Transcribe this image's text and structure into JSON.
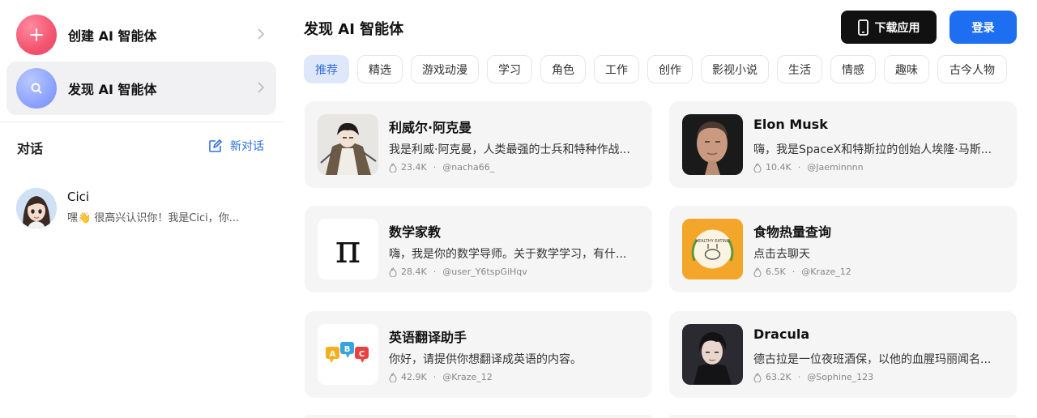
{
  "sidebar": {
    "create_label": "创建 AI 智能体",
    "discover_label": "发现 AI 智能体",
    "conversations_title": "对话",
    "new_chat_label": "新对话",
    "chats": [
      {
        "name": "Cici",
        "preview": "嘿👋 很高兴认识你！我是Cici，你..."
      }
    ]
  },
  "header": {
    "title": "发现 AI 智能体",
    "download_label": "下载应用",
    "login_label": "登录"
  },
  "tabs": [
    "推荐",
    "精选",
    "游戏动漫",
    "学习",
    "角色",
    "工作",
    "创作",
    "影视小说",
    "生活",
    "情感",
    "趣味",
    "古今人物"
  ],
  "active_tab": "推荐",
  "bots": [
    {
      "name": "利威尔·阿克曼",
      "desc": "我是利威·阿克曼，人类最强的士兵和特种作战...",
      "count": "23.4K",
      "author": "@nacha66_",
      "thumb": "anime-character-avatar"
    },
    {
      "name": "Elon Musk",
      "desc": "嗨，我是SpaceX和特斯拉的创始人埃隆·马斯...",
      "count": "10.4K",
      "author": "@Jaeminnnn",
      "thumb": "portrait-photo"
    },
    {
      "name": "数学家教",
      "desc": "嗨，我是你的数学导师。关于数学学习，有什...",
      "count": "28.4K",
      "author": "@user_Y6tspGiHqv",
      "thumb": "pi-symbol",
      "thumb_text": "π"
    },
    {
      "name": "食物热量查询",
      "desc": "点击去聊天",
      "count": "6.5K",
      "author": "@Kraze_12",
      "thumb": "healthy-eating-logo",
      "thumb_text": "HEALTHY EATING"
    },
    {
      "name": "英语翻译助手",
      "desc": "你好，请提供你想翻译成英语的内容。",
      "count": "42.9K",
      "author": "@Kraze_12",
      "thumb": "abc-bubbles",
      "thumb_letters": [
        "A",
        "B",
        "C"
      ]
    },
    {
      "name": "Dracula",
      "desc": "德古拉是一位夜班酒保，以他的血腥玛丽闻名...",
      "count": "63.2K",
      "author": "@Sophine_123",
      "thumb": "dark-portrait"
    }
  ],
  "colors": {
    "accent": "#1d6ef0",
    "card_bg": "#f5f5f6",
    "active_tab_bg": "#dfe8fb"
  }
}
